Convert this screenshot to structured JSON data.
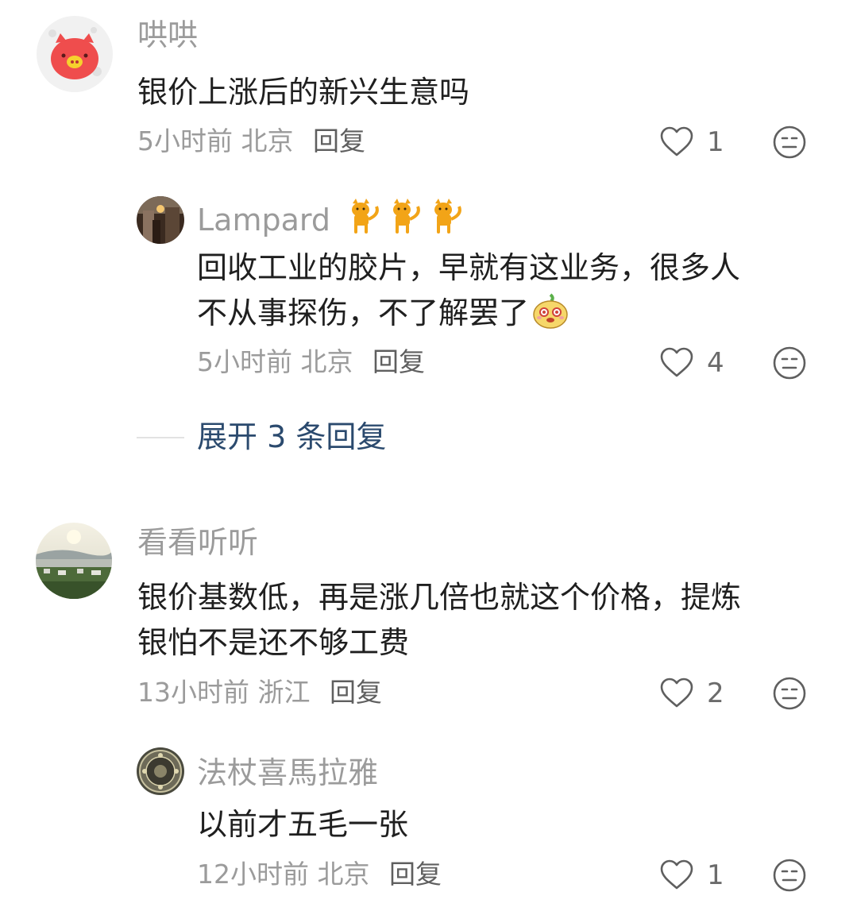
{
  "comments": [
    {
      "username": "哄哄",
      "text": "银价上涨后的新兴生意吗",
      "time": "5小时前",
      "location": "北京",
      "reply_label": "回复",
      "likes": "1"
    },
    {
      "username": "Lampard",
      "name_emoji": "cat-emoji",
      "text_line1": "回收工业的胶片，早就有这业务，很多人",
      "text_line2": "不从事探伤，不了解罢了",
      "text_emoji": "smiling-cartoon-emoji",
      "time": "5小时前",
      "location": "北京",
      "reply_label": "回复",
      "likes": "4"
    },
    {
      "username": "看看听听",
      "text_line1": "银价基数低，再是涨几倍也就这个价格，提炼",
      "text_line2": "银怕不是还不够工费",
      "time": "13小时前",
      "location": "浙江",
      "reply_label": "回复",
      "likes": "2"
    },
    {
      "username": "法杖喜馬拉雅",
      "text": "以前才五毛一张",
      "time": "12小时前",
      "location": "北京",
      "reply_label": "回复",
      "likes": "1"
    }
  ],
  "expand_replies": "展开 3 条回复",
  "colors": {
    "text": "#1f1f1f",
    "meta": "#9b9b9b",
    "link": "#2b4a6e"
  }
}
